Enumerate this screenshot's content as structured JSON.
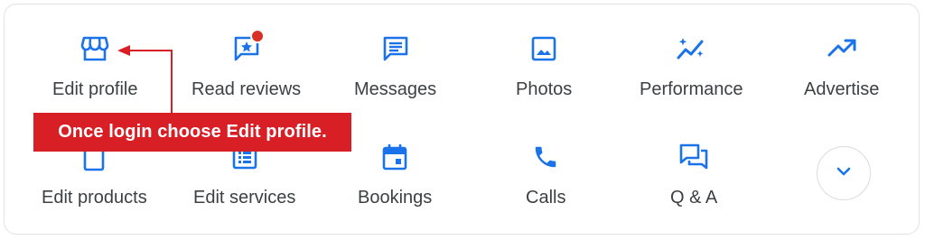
{
  "actions_row1": [
    {
      "label": "Edit profile",
      "icon": "store-icon"
    },
    {
      "label": "Read reviews",
      "icon": "star-review-icon"
    },
    {
      "label": "Messages",
      "icon": "chat-icon"
    },
    {
      "label": "Photos",
      "icon": "image-icon"
    },
    {
      "label": "Performance",
      "icon": "sparkle-trend-icon"
    },
    {
      "label": "Advertise",
      "icon": "trending-up-icon"
    }
  ],
  "actions_row2": [
    {
      "label": "Edit products",
      "icon": "product-icon"
    },
    {
      "label": "Edit services",
      "icon": "list-icon"
    },
    {
      "label": "Bookings",
      "icon": "calendar-icon"
    },
    {
      "label": "Calls",
      "icon": "phone-icon"
    },
    {
      "label": "Q & A",
      "icon": "question-answer-icon"
    }
  ],
  "expand_icon": "chevron-down-icon",
  "annotation": {
    "text": "Once login choose Edit profile."
  },
  "colors": {
    "accent": "#1a73e8",
    "badge": "#d93025",
    "callout": "#d91f26",
    "label": "#3c4043"
  }
}
